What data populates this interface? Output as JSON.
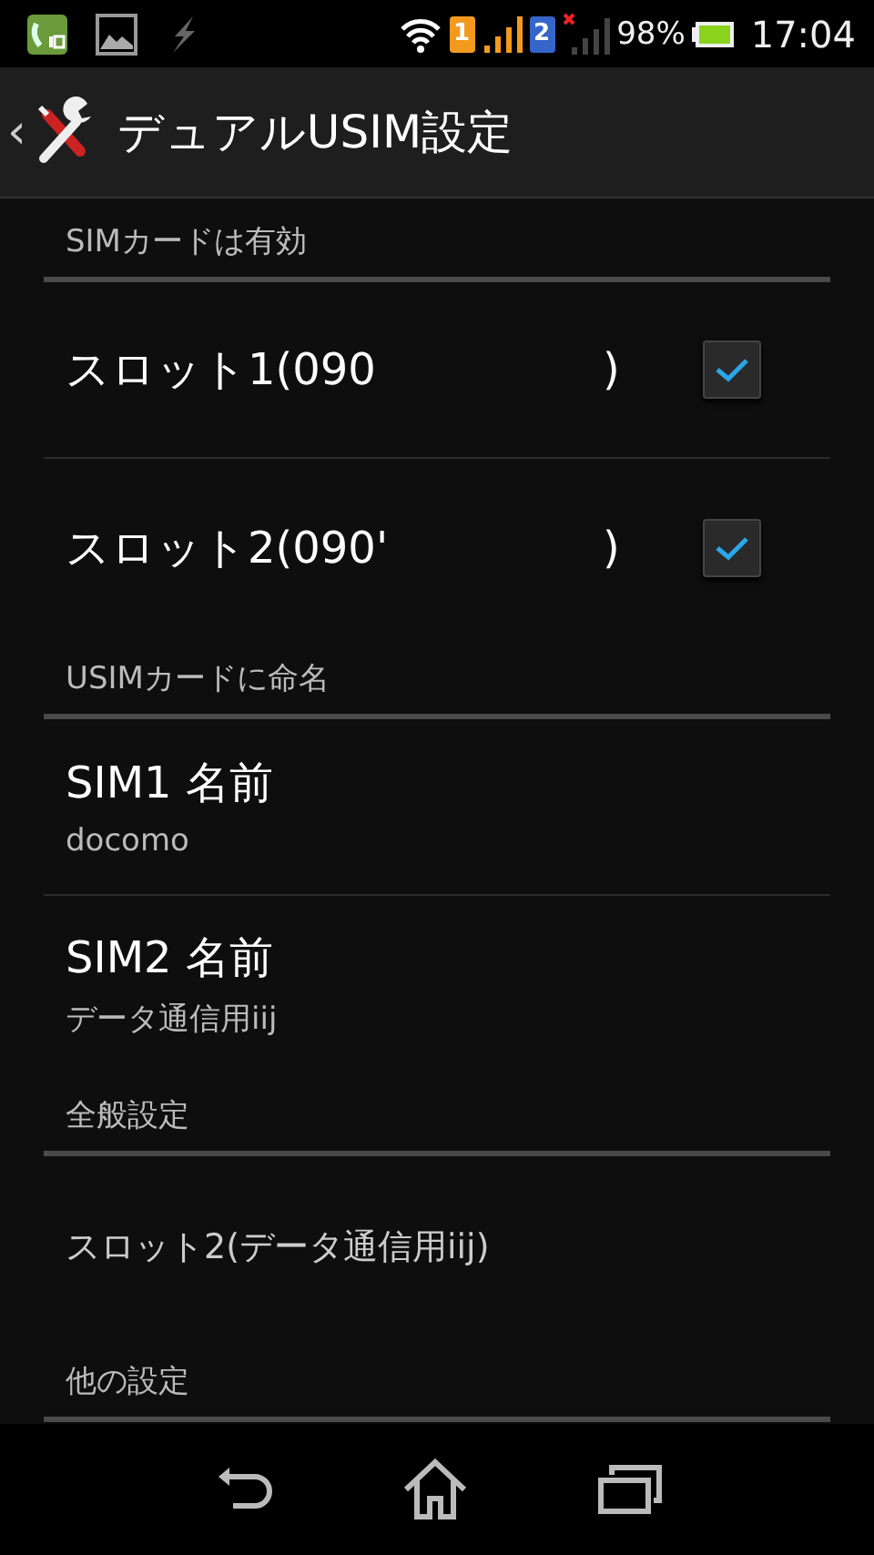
{
  "status_bar": {
    "sim1_badge": "1",
    "sim2_badge": "2",
    "battery": "98%",
    "time": "17:04"
  },
  "title_bar": {
    "back": "‹",
    "title": "デュアルUSIM設定"
  },
  "items": [
    {
      "kind": "header",
      "title": "SIMカードは有効"
    },
    {
      "kind": "checkbox",
      "title": "スロット1(090",
      "title_end": ")",
      "checked": true
    },
    {
      "kind": "checkbox",
      "title": "スロット2(090'",
      "title_end": ")",
      "checked": true
    },
    {
      "kind": "header",
      "title": "USIMカードに命名"
    },
    {
      "kind": "twoline",
      "title": "SIM1 名前",
      "summary": "docomo"
    },
    {
      "kind": "twoline",
      "title": "SIM2 名前",
      "summary": "データ通信用iij"
    },
    {
      "kind": "header",
      "title": "全般設定"
    },
    {
      "kind": "single",
      "title": "スロット2(データ通信用iij)"
    },
    {
      "kind": "header",
      "title": "他の設定"
    }
  ]
}
